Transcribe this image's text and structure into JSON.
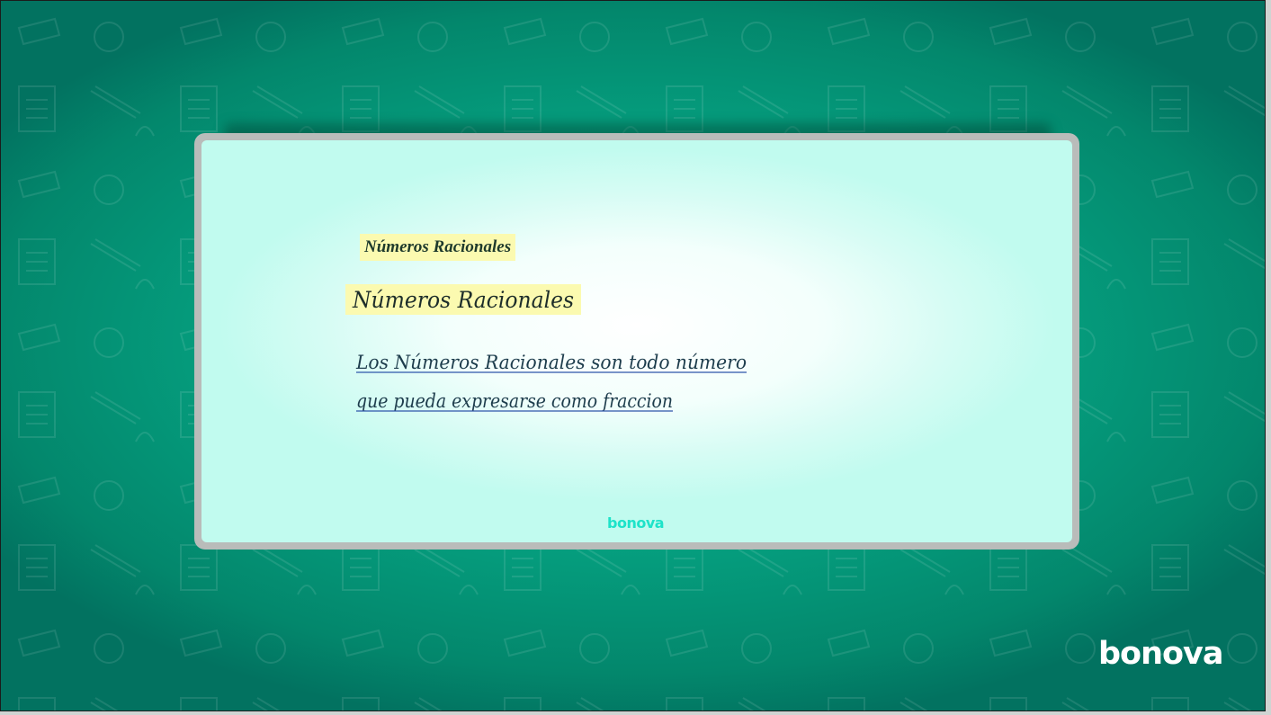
{
  "slide": {
    "title_print": "Números Racionales",
    "title_script": "Números Racionales",
    "body_line1": "Los Números Racionales son todo número",
    "body_line2": "que pueda expresarse como fraccion",
    "panel_logo": "bonova",
    "corner_logo": "bonova"
  },
  "colors": {
    "background": "#06a483",
    "highlight": "#fbfab0",
    "panel_frame": "#b9bcba",
    "panel_logo": "#1de3c9",
    "script_text": "#1d3c4c"
  }
}
